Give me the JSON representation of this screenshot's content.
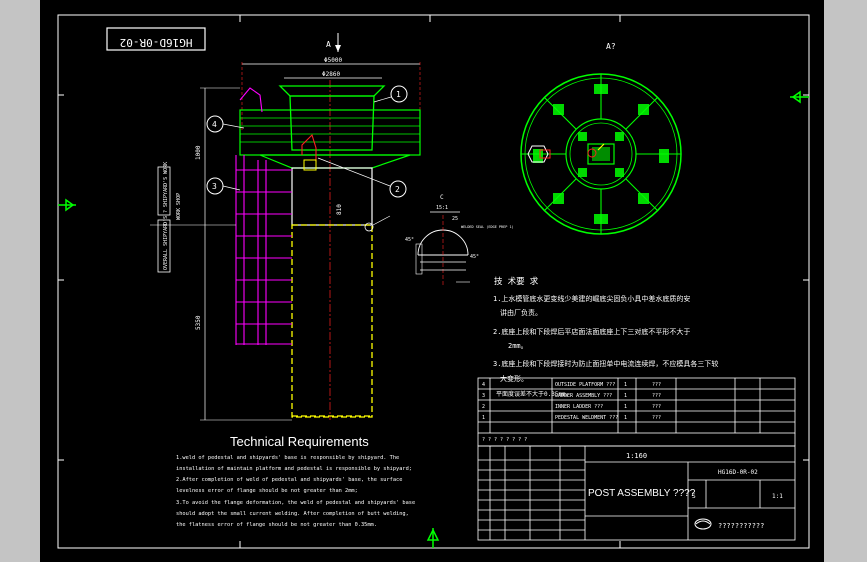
{
  "drawing_no_box": "HG16D-0R-02",
  "view_a_label": "A",
  "view_a2_label": "A?",
  "dims": {
    "d1": "Φ5000",
    "d2": "Φ2860",
    "h1": "1000",
    "h2": "5350",
    "h3": "810"
  },
  "balloons": [
    "1",
    "2",
    "3",
    "4"
  ],
  "side_labels": [
    "? SHIPYARD'S WORK",
    "OVERALL SHIPYARD'S",
    "WORK SHOP"
  ],
  "detail": {
    "title": "C",
    "scale": "15:1",
    "dim1": "25",
    "angle1": "45°",
    "angle2": "45°",
    "note": "WELDED SEAL (EDGE PREP 1)"
  },
  "cn_tech": {
    "title": "技 术要 求",
    "line1": "1.上水模管底水更变线少美建的崛底尖固负小具中差水底质的安",
    "line1b": "讲由厂负责。",
    "line2": "2.底座上段和下段焊后平店面法面底座上下三对底不平形不大于",
    "line2b": "2mm。",
    "line3": "3.底座上段和下段焊接时为防止面扭单中电流连续焊，不应模具各三下较",
    "line3b": "大变形。"
  },
  "en_tech": {
    "title": "Technical Requirements",
    "lines": [
      "1.weld of pedestal and shipyards' base is responsible by shipyard. The",
      "installation of maintain platform and pedestal is responsible by shipyard;",
      "2.After completion of weld of pedestal and shipyards' base, the surface",
      "levelness error of flange should be not greater than 2mm;",
      "3.To avoid the flange deformation, the weld of pedestal and shipyards' base",
      "should adopt the small current welding. After completion of butt welding,",
      "the flatness error of flange should be not greater than 0.35mm."
    ]
  },
  "parts": [
    {
      "no": "4",
      "name": "OUTSIDE PLATFORM ???",
      "qty": "1",
      "mat": "???"
    },
    {
      "no": "3",
      "name": "LADDER ASSEMBLY ???",
      "qty": "1",
      "mat": "???"
    },
    {
      "no": "2",
      "name": "INNER LADDER ???",
      "qty": "1",
      "mat": "???"
    },
    {
      "no": "1",
      "name": "PEDESTAL WELDMENT ???",
      "qty": "1",
      "mat": "???"
    }
  ],
  "overlap_text": "平面度误差不大于0.35mm。",
  "title_block": {
    "scale_text": "1:160",
    "title": "POST ASSEMBLY ????",
    "drawing_no": "HG16D-0R-02",
    "sheet": "1:1",
    "weight": "S",
    "company": "???????????",
    "head_marks": "? ? ? ? ? ? ? ?"
  },
  "colors": {
    "green": "#00ff00",
    "yellow": "#ffff00",
    "magenta": "#ff00ff",
    "red": "#ff2020",
    "white": "#ffffff",
    "bg": "#000000"
  }
}
